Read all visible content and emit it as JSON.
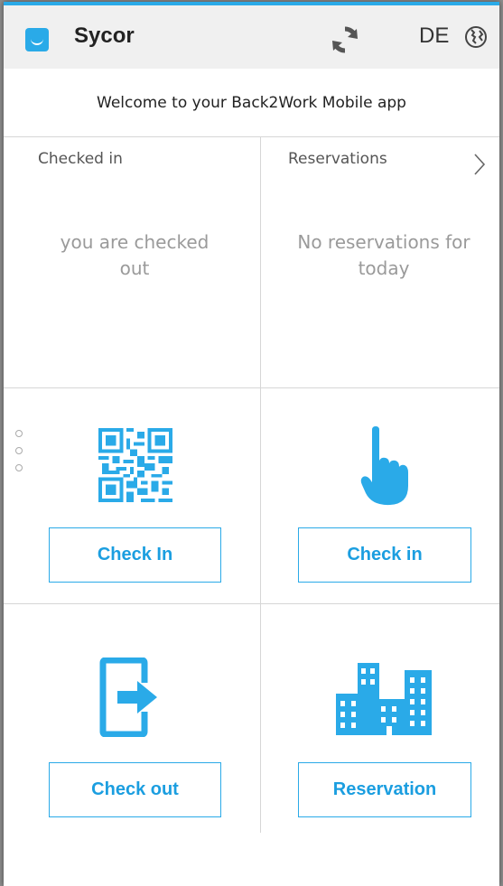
{
  "header": {
    "title": "Sycor",
    "language": "DE"
  },
  "welcome_text": "Welcome to your Back2Work Mobile app",
  "status_panel": {
    "checked_in_label": "Checked in",
    "checked_in_value": "you are checked out",
    "reservations_label": "Reservations",
    "reservations_value": "No reservations for today"
  },
  "actions": {
    "qr_check_in": "Check In",
    "manual_check_in": "Check in",
    "check_out": "Check out",
    "reservation": "Reservation"
  },
  "colors": {
    "accent": "#2aaae8",
    "button_text": "#1b9ee0"
  },
  "icons": [
    "app-logo",
    "refresh-icon",
    "globe-icon",
    "chevron-right-icon",
    "qr-code-icon",
    "pointing-hand-icon",
    "exit-door-icon",
    "buildings-icon"
  ]
}
